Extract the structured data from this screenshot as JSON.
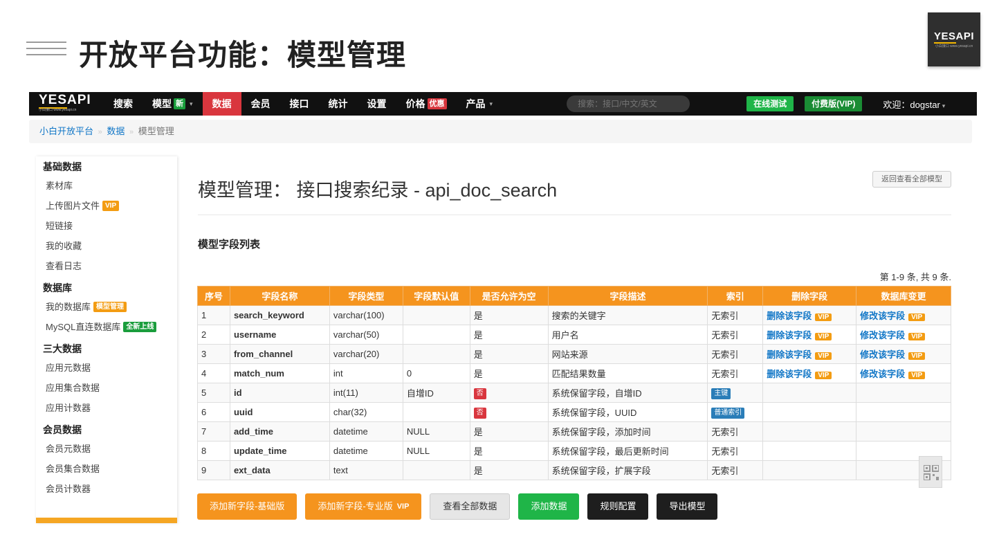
{
  "slide": {
    "title": "开放平台功能：模型管理",
    "logo_text_a": "YES",
    "logo_text_b": "API",
    "logo_sub": "小白接口 www.yesapi.cn"
  },
  "navbar": {
    "logo_a": "YES",
    "logo_b": "API",
    "logo_sub": "小白接口 www.yesapi.cn",
    "items": [
      {
        "label": "搜索"
      },
      {
        "label": "模型",
        "badge": "新",
        "caret": "▾"
      },
      {
        "label": "数据",
        "active": true
      },
      {
        "label": "会员"
      },
      {
        "label": "接口"
      },
      {
        "label": "统计"
      },
      {
        "label": "设置"
      },
      {
        "label": "价格",
        "badge": "优惠"
      },
      {
        "label": "产品",
        "caret": "▾"
      }
    ],
    "search_placeholder": "搜索：接口/中文/英文",
    "btn_online_test": "在线测试",
    "btn_vip": "付费版(VIP)",
    "welcome": "欢迎：dogstar",
    "welcome_caret": "▾"
  },
  "breadcrumb": {
    "home": "小白开放平台",
    "sep": "»",
    "level2": "数据",
    "current": "模型管理"
  },
  "sidebar": {
    "groups": [
      {
        "title": "基础数据",
        "items": [
          {
            "label": "素材库"
          },
          {
            "label": "上传图片文件",
            "tag": "VIP"
          },
          {
            "label": "短链接"
          },
          {
            "label": "我的收藏"
          },
          {
            "label": "查看日志"
          }
        ]
      },
      {
        "title": "数据库",
        "items": [
          {
            "label": "我的数据库",
            "tag": "模型管理"
          },
          {
            "label": "MySQL直连数据库",
            "tag": "全新上线"
          }
        ]
      },
      {
        "title": "三大数据",
        "items": [
          {
            "label": "应用元数据"
          },
          {
            "label": "应用集合数据"
          },
          {
            "label": "应用计数器"
          }
        ]
      },
      {
        "title": "会员数据",
        "items": [
          {
            "label": "会员元数据"
          },
          {
            "label": "会员集合数据"
          },
          {
            "label": "会员计数器"
          }
        ]
      }
    ]
  },
  "main": {
    "title": "模型管理：  接口搜索纪录 - api_doc_search",
    "back_button": "返回查看全部模型",
    "section_title": "模型字段列表",
    "summary": "第 1-9 条, 共 9 条.",
    "table": {
      "headers": [
        "序号",
        "字段名称",
        "字段类型",
        "字段默认值",
        "是否允许为空",
        "字段描述",
        "索引",
        "删除字段",
        "数据库变更"
      ],
      "rows": [
        {
          "no": "1",
          "name": "search_keyword",
          "type": "varchar(100)",
          "default": "",
          "nullable": "是",
          "desc": "搜索的关键字",
          "index": "无索引",
          "del": "删除该字段",
          "mod": "修改该字段"
        },
        {
          "no": "2",
          "name": "username",
          "type": "varchar(50)",
          "default": "",
          "nullable": "是",
          "desc": "用户名",
          "index": "无索引",
          "del": "删除该字段",
          "mod": "修改该字段"
        },
        {
          "no": "3",
          "name": "from_channel",
          "type": "varchar(20)",
          "default": "",
          "nullable": "是",
          "desc": "网站来源",
          "index": "无索引",
          "del": "删除该字段",
          "mod": "修改该字段"
        },
        {
          "no": "4",
          "name": "match_num",
          "type": "int",
          "default": "0",
          "nullable": "是",
          "desc": "匹配结果数量",
          "index": "无索引",
          "del": "删除该字段",
          "mod": "修改该字段"
        },
        {
          "no": "5",
          "name": "id",
          "type": "int(11)",
          "default": "自增ID",
          "nullable": "否",
          "desc": "系统保留字段，自增ID",
          "index": "主键",
          "del": "",
          "mod": ""
        },
        {
          "no": "6",
          "name": "uuid",
          "type": "char(32)",
          "default": "",
          "nullable": "否",
          "desc": "系统保留字段，UUID",
          "index": "普通索引",
          "del": "",
          "mod": ""
        },
        {
          "no": "7",
          "name": "add_time",
          "type": "datetime",
          "default": "NULL",
          "nullable": "是",
          "desc": "系统保留字段，添加时间",
          "index": "无索引",
          "del": "",
          "mod": ""
        },
        {
          "no": "8",
          "name": "update_time",
          "type": "datetime",
          "default": "NULL",
          "nullable": "是",
          "desc": "系统保留字段，最后更新时间",
          "index": "无索引",
          "del": "",
          "mod": ""
        },
        {
          "no": "9",
          "name": "ext_data",
          "type": "text",
          "default": "",
          "nullable": "是",
          "desc": "系统保留字段，扩展字段",
          "index": "无索引",
          "del": "",
          "mod": ""
        }
      ],
      "vip_tag": "VIP"
    },
    "actions": {
      "add_basic": "添加新字段-基础版",
      "add_pro": "添加新字段-专业版",
      "add_pro_tag": "VIP",
      "view_all": "查看全部数据",
      "add_data": "添加数据",
      "rules": "规则配置",
      "export": "导出模型"
    }
  },
  "colors": {
    "accent_orange": "#f5941e",
    "nav_active_red": "#d9363e",
    "green": "#1fb548",
    "link_blue": "#1277c7"
  }
}
